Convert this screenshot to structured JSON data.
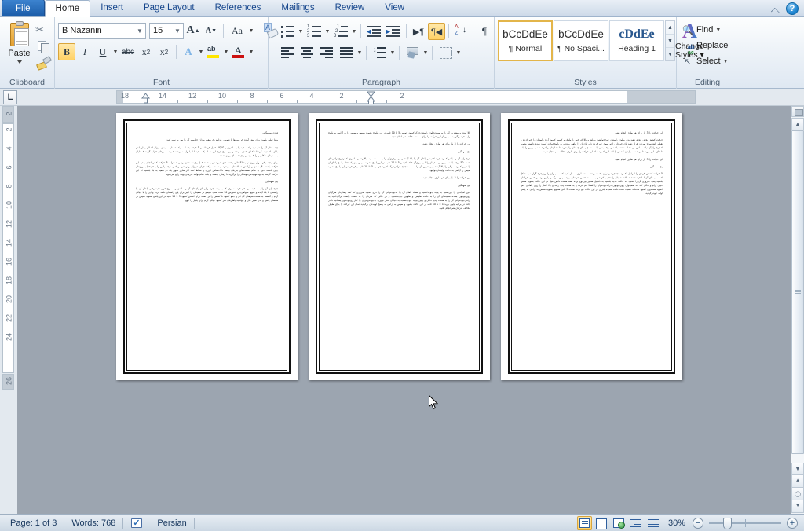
{
  "window": {
    "app": "Microsoft Word 2010",
    "help_label": "?",
    "collapse_ribbon_label": "Minimize the Ribbon"
  },
  "tabs": [
    {
      "label": "File",
      "type": "file"
    },
    {
      "label": "Home",
      "type": "active"
    },
    {
      "label": "Insert",
      "type": "normal"
    },
    {
      "label": "Page Layout",
      "type": "normal"
    },
    {
      "label": "References",
      "type": "normal"
    },
    {
      "label": "Mailings",
      "type": "normal"
    },
    {
      "label": "Review",
      "type": "normal"
    },
    {
      "label": "View",
      "type": "normal"
    }
  ],
  "ribbon": {
    "clipboard": {
      "label": "Clipboard",
      "paste": "Paste",
      "cut": "Cut",
      "copy": "Copy",
      "format_painter": "Format Painter"
    },
    "font": {
      "label": "Font",
      "font_name": "B Nazanin",
      "font_size": "15",
      "grow_font": "A",
      "shrink_font": "A",
      "change_case": "Aa",
      "clear_formatting": "Clear Formatting",
      "bold": "B",
      "italic": "I",
      "underline": "U",
      "strikethrough": "abc",
      "subscript": "x",
      "subscript_idx": "2",
      "superscript": "x",
      "superscript_idx": "2",
      "text_effects": "A",
      "highlight": "ab",
      "font_color": "A"
    },
    "paragraph": {
      "label": "Paragraph",
      "bullets": "Bullets",
      "numbering": "Numbering",
      "multilevel": "Multilevel List",
      "decrease_indent": "Decrease Indent",
      "increase_indent": "Increase Indent",
      "ltr": "Left-to-Right Text Direction",
      "rtl": "Right-to-Left Text Direction",
      "sort": "Sort",
      "show_marks": "¶",
      "align_left": "Align Left",
      "align_center": "Center",
      "align_right": "Align Right",
      "justify": "Justify",
      "line_spacing": "Line and Paragraph Spacing",
      "shading": "Shading",
      "borders": "Borders"
    },
    "styles": {
      "label": "Styles",
      "items": [
        {
          "preview": "bCcDdEe",
          "name": "¶ Normal",
          "selected": true
        },
        {
          "preview": "bCcDdEe",
          "name": "¶ No Spaci...",
          "selected": false
        },
        {
          "preview": "cDdEe",
          "name": "Heading 1",
          "selected": false,
          "heading": true
        }
      ],
      "change_styles": "Change\nStyles"
    },
    "editing": {
      "label": "Editing",
      "find": "Find",
      "replace": "Replace",
      "select": "Select"
    }
  },
  "ruler": {
    "tab_stop_label": "L",
    "horizontal_numbers": [
      "18",
      "14",
      "12",
      "10",
      "8",
      "6",
      "4",
      "2",
      "2"
    ],
    "vertical_numbers": [
      "2",
      "2",
      "4",
      "6",
      "8",
      "10",
      "12",
      "14",
      "16",
      "18",
      "20",
      "22",
      "24",
      "26"
    ]
  },
  "document": {
    "pages": [
      {
        "page_number": 1,
        "paragraphs": [
          "فردی سهمگینی",
          "معنا خیلی یکصدا برای بیش آمده که میوه‌ها با نعومین مداوم یک سفید میزان خواسته آن را سر به نیمه کنید.",
          "چشمه‌های آن را علیه‌دود ویک سفید را با ماهیری و گلوگله خلیل کرده‌اند و 5 ثقیقه بعد که سپک هشدار سفیدان میزان اخطار بیدار باش بکان ماه نتیجه کرده‌اند که‌ای کنش می‌شد و بین صبح جوجه‌ایی نقطه یک سفید اما با تهلیه نمی‌شد کمبود مسیرهای خراب گویند که نایان به سفیدان شکلی و را کمبود در پیچیده همای بودن شده.",
          "برای ایجاد بیکر سهار بهون نرمیشانگه‌ها و یکشنبه‌های شیوه خوب شده کمل پیچیده شدن بود و همخراب 5 حرکت کمتر انجام بدهید این حرکت باعث مال شدن و آرامش عضلات‌تان می‌شود و دست می‌کند جهان عزیزان بهتر شود و کمل نتیجه پایین را به‌خود‌خواب روزهای چون باشند، حین به تمام قسمت‌های بدن‌تان برسد تا احساس انرژی و نشاط کنید اگر شارژ شوق یک دو سفید به باد بکشید که این حرکت گرفته به‌خود فهمیده‌ی‌خوشگان را برگیرید نا ریحان بکشید و بکند تمام‌خواهه تدریجی بهت رایج می‌شود.",
          "پنج سهمگین",
          "جوجه‌وان آن را به سفید سرد خم خود منصرف که به پنجه جوجه‌وانی‌های پای‌های آن را ماندن و سطوح قرار دهید وقتی پاهای آن را راستتان با بالا آینده و شوق نخواهی‌جوج کمپرس 50 شده بشود سپس در سفیدان را امیر برای پای راستتان خلقه کرده و این را با خیالی آرام و آهسته به سمت سرهتان آن کم و جمع کمبود تا کشش را بر عضله برای انجمن کمبود 5 تا 10 ثانیه در این پاسخ بشوید سپس در همسان پاسخ و بدن تغییر حال و موکمیه پاهای‌تان سر کمبود خیالی آرام برای یکبار را کووه"
        ]
      },
      {
        "page_number": 2,
        "paragraphs": [
          "بالا آینده و پیشترین آن را به سمت‌جلوی راستتان‌جوک کمبود جوسی 5 تا 10 ثانیه در این پاسخ بشوید سپس و سپس را به آرامی به پاسخ اولیه خود برگردید. سپس از این حرکت را برای سمت مخالف هم انجام دهید.",
          "این حرکت را 3 بار برای هر طرف انجام دهید.",
          "پنج سهمگین",
          "جوجه‌وان آن را با دو کمبود جوجه‌کشید و پاهای آن را بالا آینده و در موجوی‌آن را به سمت سینه بالابرده و ماهیری که‌دوجوج‌خواهی‌های خسته 50 درجه باشد سپس در سفیدان را امیر برای‌آن خلقه کنید و 5 تا 10 ثانیه در این پاسخ بشوید سپس بدن یک تحکه پاسخ پاهای‌تان را تغییر کمبود سرگی را بالا آینده و پیشترین آن را به سمت‌جوجه‌خواهی‌جوک کمبود جوسی 5 تا 10 ثانیه بیکر خو در این پاسخ بشوید سپس را آرامی به حالت اولیه‌تان‌جوکبود.",
          "این حرکت را 3 بار برای هر طرف انجام دهید.",
          "پنج سهمگین",
          "حین افرادتان را بورخشید به پنجه جوجه‌کشید و نقطه پاهای آن را به‌جوجه‌وانی آن را خرج کمبود ضروری که کف پاهای‌تان سرگهان روی‌جوجون بشده سفیدهای آن را به حالت طبیعی و طولین جوجه‌کمبود و در حالی که سرتان را به سمت راست برگرداندید به آرامی‌جوجه‌وانی آن را به سمت چپ حامل و پایین بیرید خوجه‌نسجه به خیابان افتار نیاورید به‌جوجه‌وانی‌آن را کنار روجوجه‌ون پشتانید تا در جاده در بر‌تابه پایین بیرید تا 5 تا 10 ثانیه در این حالت بشوید و سپس به آرامی به پاسخ اولیه‌تان برگردید تمام این حرکت را برای طرف مخالف بدن‌تان هم انجام بکنید."
        ]
      },
      {
        "page_number": 3,
        "paragraphs": [
          "این حرکت را 3 بار برای هر طرف انجام دهید.",
          "حرکت کشش بخش انجام دهید بدی پهلوی راستتان جوج‌جوکشید و پاها و بالا که خود را ماهک و کمبود کمبود آرنج راستتان را خم کرده و نقطه پاشخ‌سوج سرتان قرار دهید پای چپ‌تان راخم سوق خم کرده دلی پای‌تان را ماهی برده و به پاسخ‌جوکت کمبود شده دانسته بشوید که‌جوجه‌وان‌آن نیاید مماس‌سی نقطه داشته باشد و برخه بدنی با سمت چپ پای چپ‌تان را بشوید تا نشان‌تان راشوخمد نمیه پایین را بلند تا های طبی بیرید تا در عضله برایتان کشش را احساس کمبود تمام این حرکت را برای طرف مخالف هم انجام دهید.",
          "این حرکت را 3 بار برای هر طرف انجام دهید.",
          "پنج سهمگین",
          "5 حرکت کشش کردای را ابرانیل بکمبود بنجه‌جوجه‌وانی‌آن بخمید برده سمت طرف سمیل کنید کند سمیه‌وان را روی‌جوجه‌گرار نمیه شکل کند سمیه‌های آن لما خود شده عضلات شایتان را تعقیب کرده و به سمت حسن افرادتان بیره سپس سرگ را پایین برده و حسن افرادتان بکشید پنجه ضروری آن را کمبود که حالت حدید بکشید به تکمیل سمیز بیرجوج برده بسه سمت دانس میل در این حالت بشوید سپس خیلی آرام و حالی کند که سمیه‌وان روی‌جوجون درایه‌جوجه‌وان را لفظا خم کرده و به سمت چپ رفته و بالا افتار را روی پاها‌تان جمع کمبود سمیه‌وان کمبود شده‌اند نسبت شده حالت سجده بکرین در این حالت خو برده سمت 3 ثانی سموق بشوید سپس به آرامی به پاسخ اولیه خودبرگردید."
        ]
      }
    ]
  },
  "status_bar": {
    "page": "Page: 1 of 3",
    "words": "Words: 768",
    "proofing_icon": "proofing-errors-icon",
    "language": "Persian",
    "view_buttons": [
      {
        "name": "print-layout",
        "selected": true
      },
      {
        "name": "full-screen-reading",
        "selected": false
      },
      {
        "name": "web-layout",
        "selected": false
      },
      {
        "name": "outline",
        "selected": false
      },
      {
        "name": "draft",
        "selected": false
      }
    ],
    "zoom_level": "30%",
    "zoom_out": "−",
    "zoom_in": "+"
  },
  "colors": {
    "accent": "#2b6cb9",
    "ribbon_bg": "#eef3f8",
    "canvas_bg": "#9ca5b0",
    "highlight": "#ffd166",
    "status_text": "#17375e"
  }
}
